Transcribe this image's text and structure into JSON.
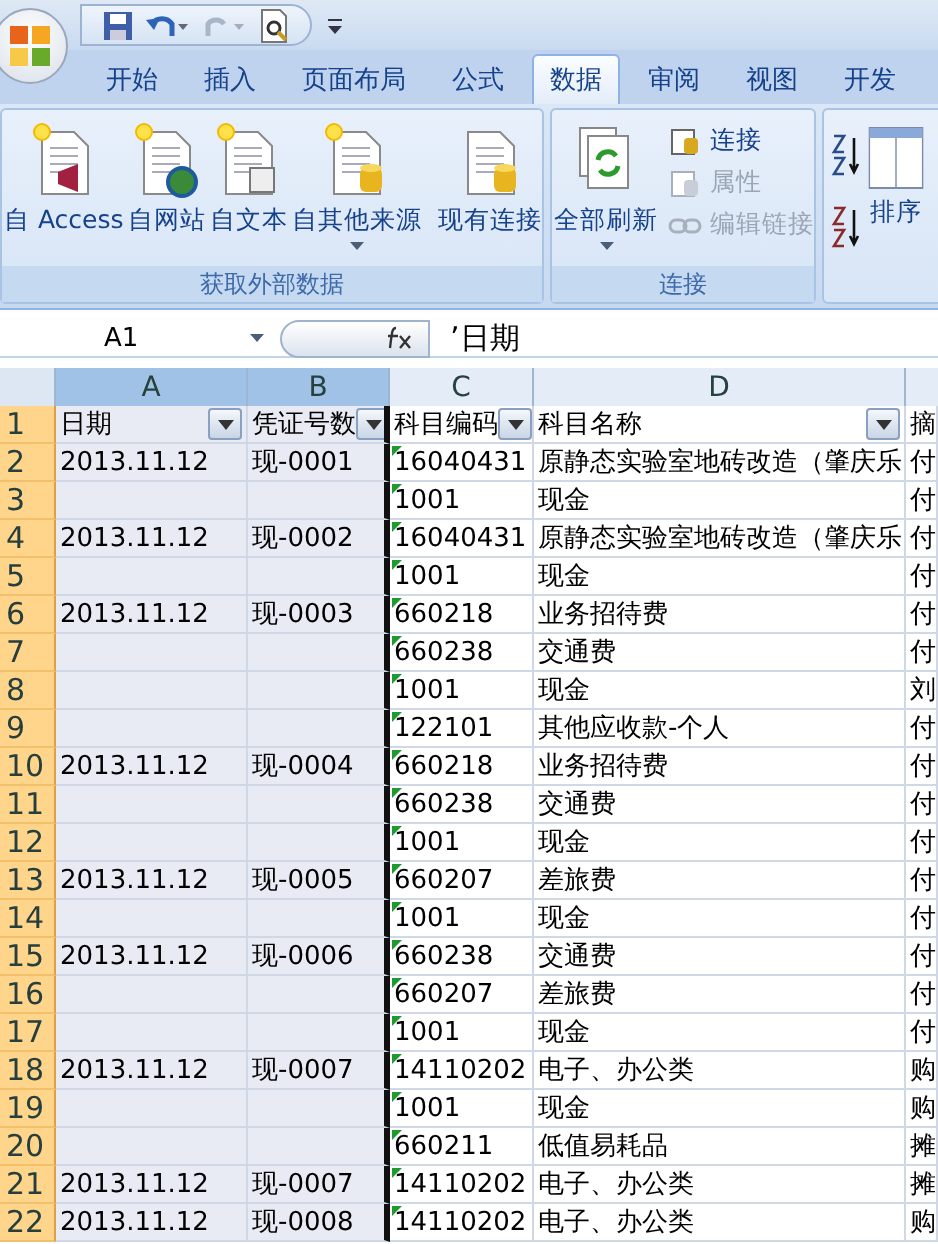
{
  "tabs": [
    {
      "label": "开始",
      "selected": false
    },
    {
      "label": "插入",
      "selected": false
    },
    {
      "label": "页面布局",
      "selected": false
    },
    {
      "label": "公式",
      "selected": false
    },
    {
      "label": "数据",
      "selected": true
    },
    {
      "label": "审阅",
      "selected": false
    },
    {
      "label": "视图",
      "selected": false
    },
    {
      "label": "开发",
      "selected": false
    }
  ],
  "ribbon": {
    "external": {
      "label": "获取外部数据",
      "buttons": [
        {
          "label": "自 Access",
          "dropdown": false
        },
        {
          "label": "自网站",
          "dropdown": false
        },
        {
          "label": "自文本",
          "dropdown": false
        },
        {
          "label": "自其他来源",
          "dropdown": true
        }
      ],
      "existing": "现有连接"
    },
    "connections": {
      "label": "连接",
      "refresh": "全部刷新",
      "items": [
        {
          "label": "连接",
          "disabled": false
        },
        {
          "label": "属性",
          "disabled": true
        },
        {
          "label": "编辑链接",
          "disabled": true
        }
      ]
    },
    "sort": {
      "label": "排序"
    }
  },
  "formula_bar": {
    "name_box": "A1",
    "formula": "’日期"
  },
  "columns": [
    {
      "label": "A",
      "selected": true
    },
    {
      "label": "B",
      "selected": true
    },
    {
      "label": "C",
      "selected": false
    },
    {
      "label": "D",
      "selected": false
    }
  ],
  "header_row": {
    "number": "1",
    "cells": [
      {
        "text": "日期",
        "filter": true
      },
      {
        "text": "凭证号数",
        "filter": true
      },
      {
        "text": "科目编码",
        "filter": true
      },
      {
        "text": "科目名称",
        "filter": true
      },
      {
        "text": "摘"
      }
    ]
  },
  "rows": [
    {
      "number": "2",
      "cells": [
        "2013.11.12",
        "现-0001",
        "16040431",
        "原静态实验室地砖改造（肇庆乐",
        "付"
      ]
    },
    {
      "number": "3",
      "cells": [
        "",
        "",
        "1001",
        "现金",
        "付"
      ]
    },
    {
      "number": "4",
      "cells": [
        "2013.11.12",
        "现-0002",
        "16040431",
        "原静态实验室地砖改造（肇庆乐",
        "付"
      ]
    },
    {
      "number": "5",
      "cells": [
        "",
        "",
        "1001",
        "现金",
        "付"
      ]
    },
    {
      "number": "6",
      "cells": [
        "2013.11.12",
        "现-0003",
        "660218",
        "业务招待费",
        "付"
      ]
    },
    {
      "number": "7",
      "cells": [
        "",
        "",
        "660238",
        "交通费",
        "付"
      ]
    },
    {
      "number": "8",
      "cells": [
        "",
        "",
        "1001",
        "现金",
        "刘"
      ]
    },
    {
      "number": "9",
      "cells": [
        "",
        "",
        "122101",
        "其他应收款-个人",
        "付"
      ]
    },
    {
      "number": "10",
      "cells": [
        "2013.11.12",
        "现-0004",
        "660218",
        "业务招待费",
        "付"
      ]
    },
    {
      "number": "11",
      "cells": [
        "",
        "",
        "660238",
        "交通费",
        "付"
      ]
    },
    {
      "number": "12",
      "cells": [
        "",
        "",
        "1001",
        "现金",
        "付"
      ]
    },
    {
      "number": "13",
      "cells": [
        "2013.11.12",
        "现-0005",
        "660207",
        "差旅费",
        "付"
      ]
    },
    {
      "number": "14",
      "cells": [
        "",
        "",
        "1001",
        "现金",
        "付"
      ]
    },
    {
      "number": "15",
      "cells": [
        "2013.11.12",
        "现-0006",
        "660238",
        "交通费",
        "付"
      ]
    },
    {
      "number": "16",
      "cells": [
        "",
        "",
        "660207",
        "差旅费",
        "付"
      ]
    },
    {
      "number": "17",
      "cells": [
        "",
        "",
        "1001",
        "现金",
        "付"
      ]
    },
    {
      "number": "18",
      "cells": [
        "2013.11.12",
        "现-0007",
        "14110202",
        "电子、办公类",
        "购"
      ]
    },
    {
      "number": "19",
      "cells": [
        "",
        "",
        "1001",
        "现金",
        "购"
      ]
    },
    {
      "number": "20",
      "cells": [
        "",
        "",
        "660211",
        "低值易耗品",
        "摊"
      ]
    },
    {
      "number": "21",
      "cells": [
        "2013.11.12",
        "现-0007",
        "14110202",
        "电子、办公类",
        "摊"
      ]
    },
    {
      "number": "22",
      "cells": [
        "2013.11.12",
        "现-0008",
        "14110202",
        "电子、办公类",
        "购"
      ]
    }
  ],
  "text_number_marks": true
}
